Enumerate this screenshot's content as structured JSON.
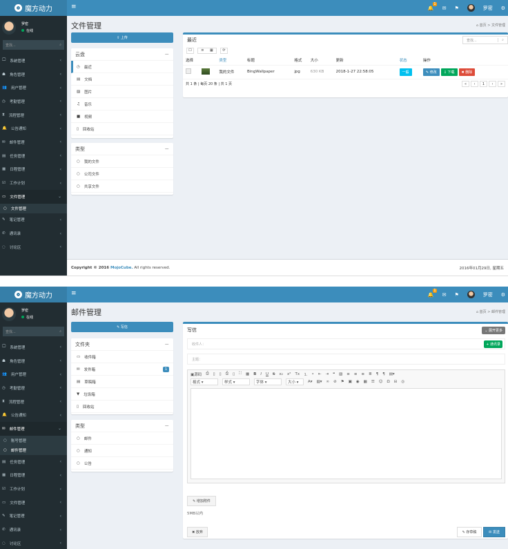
{
  "app": {
    "logo": "魔方动力",
    "user_name": "罗密",
    "user_status": "在线",
    "search_placeholder": "查找...",
    "notification_count": "1"
  },
  "sidebar1": [
    {
      "icon": "🖵",
      "label": "系统管理"
    },
    {
      "icon": "☗",
      "label": "角色管理"
    },
    {
      "icon": "👥",
      "label": "用户管理"
    },
    {
      "icon": "◷",
      "label": "考勤管理"
    },
    {
      "icon": "⧗",
      "label": "流程管理"
    },
    {
      "icon": "🔔",
      "label": "公告通知"
    },
    {
      "icon": "✉",
      "label": "邮件管理"
    },
    {
      "icon": "▤",
      "label": "任务管理"
    },
    {
      "icon": "▦",
      "label": "日程管理"
    },
    {
      "icon": "☑",
      "label": "工作计划"
    },
    {
      "icon": "▭",
      "label": "文件管理",
      "open": true
    },
    {
      "icon": "○",
      "label": "文件管理",
      "sub": true,
      "active": true
    },
    {
      "icon": "✎",
      "label": "笔记管理"
    },
    {
      "icon": "✆",
      "label": "通讯录"
    },
    {
      "icon": "◌",
      "label": "讨论区"
    }
  ],
  "sidebar2": [
    {
      "icon": "🖵",
      "label": "系统管理"
    },
    {
      "icon": "☗",
      "label": "角色管理"
    },
    {
      "icon": "👥",
      "label": "用户管理"
    },
    {
      "icon": "◷",
      "label": "考勤管理"
    },
    {
      "icon": "⧗",
      "label": "流程管理"
    },
    {
      "icon": "🔔",
      "label": "公告通知"
    },
    {
      "icon": "✉",
      "label": "邮件管理",
      "open": true
    },
    {
      "icon": "○",
      "label": "账号管理",
      "sub": true
    },
    {
      "icon": "○",
      "label": "邮件管理",
      "sub": true,
      "active": true
    },
    {
      "icon": "▤",
      "label": "任务管理"
    },
    {
      "icon": "▦",
      "label": "日程管理"
    },
    {
      "icon": "☑",
      "label": "工作计划"
    },
    {
      "icon": "▭",
      "label": "文件管理"
    },
    {
      "icon": "✎",
      "label": "笔记管理"
    },
    {
      "icon": "✆",
      "label": "通讯录"
    },
    {
      "icon": "◌",
      "label": "讨论区"
    }
  ],
  "files": {
    "title": "文件管理",
    "breadcrumb": [
      "首页",
      "文件管理"
    ],
    "upload_label": "上传",
    "cloud_title": "云盘",
    "cloud_items": [
      {
        "icon": "◷",
        "label": "最近"
      },
      {
        "icon": "▤",
        "label": "文档"
      },
      {
        "icon": "▨",
        "label": "图片"
      },
      {
        "icon": "♫",
        "label": "音乐"
      },
      {
        "icon": "■",
        "label": "视频"
      },
      {
        "icon": "▯",
        "label": "回收站"
      }
    ],
    "type_title": "类型",
    "type_items": [
      "我的文件",
      "公司文件",
      "共享文件"
    ],
    "list_title": "最近",
    "search_placeholder": "查找...",
    "columns": [
      "选择",
      "",
      "类型",
      "标题",
      "格式",
      "大小",
      "更新",
      "状态",
      "操作"
    ],
    "rows": [
      {
        "type": "我的文件",
        "title": "BingWallpaper",
        "format": "jpg",
        "size": "630 KB",
        "updated": "2018-1-27 22:58:05",
        "status": "一般",
        "actions": [
          "修改",
          "下载",
          "删除"
        ]
      }
    ],
    "summary": "共 1 条 | 每页 20 条 | 共 1 页",
    "pages": [
      "«",
      "‹",
      "1",
      "›",
      "»"
    ],
    "footer_copyright": "Copyright © 2016 ",
    "footer_brand": "MojoCube.",
    "footer_rights": " All rights reserved.",
    "footer_date": "2016年01月29日, 星期五"
  },
  "mail": {
    "title": "邮件管理",
    "breadcrumb": [
      "首页",
      "邮件管理"
    ],
    "compose_label": "写信",
    "folder_title": "文件夹",
    "folders": [
      {
        "icon": "▭",
        "label": "收件箱"
      },
      {
        "icon": "✉",
        "label": "发件箱",
        "count": "1"
      },
      {
        "icon": "▤",
        "label": "草稿箱"
      },
      {
        "icon": "▼",
        "label": "垃圾箱"
      },
      {
        "icon": "▯",
        "label": "回收站"
      }
    ],
    "type_title": "类型",
    "types": [
      "邮件",
      "通知",
      "公告"
    ],
    "write_title": "写信",
    "expand_label": "展开更多",
    "to_placeholder": "收件人：",
    "address_book_label": "通讯录",
    "subject_placeholder": "主题：",
    "toolbar_source": "源码",
    "toolbar_format": "格式",
    "toolbar_style": "样式",
    "toolbar_font": "字体",
    "toolbar_size": "大小",
    "attach_label": "增加附件",
    "attach_hint": "5MB以内",
    "discard_label": "放弃",
    "draft_label": "存草稿",
    "send_label": "发送"
  },
  "colors": {
    "primary": "#3c8dbc",
    "sidebar": "#222d32",
    "success": "#00a65a",
    "danger": "#dd4b39",
    "info": "#00c0ef"
  }
}
